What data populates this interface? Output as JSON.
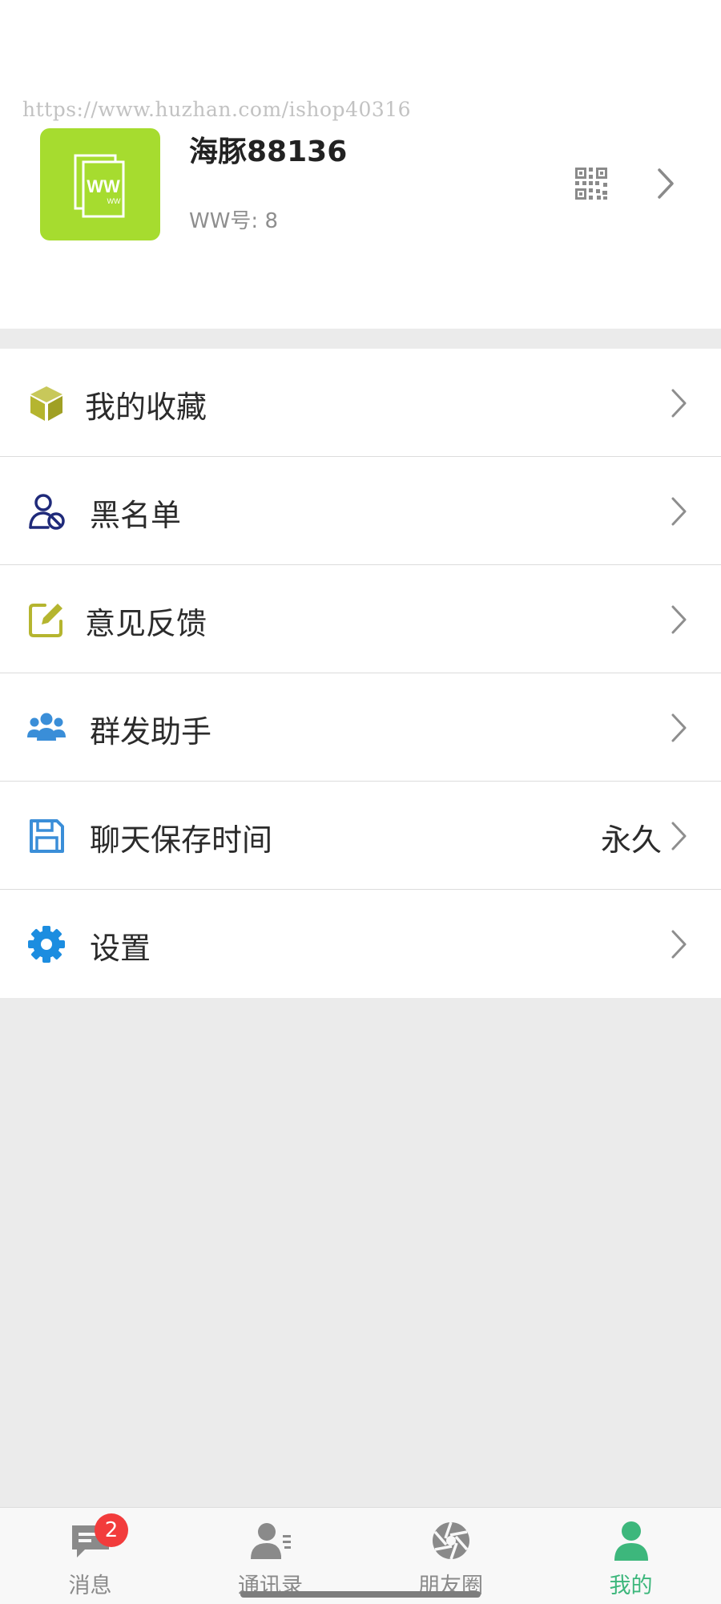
{
  "watermark": "https://www.huzhan.com/ishop40316",
  "profile": {
    "avatar_text_big": "WW",
    "avatar_text_small": "WW",
    "name": "海豚88136",
    "id_text": "WW号: 8",
    "avatar_color": "#a6dc2f"
  },
  "menu": {
    "items": [
      {
        "label": "我的收藏",
        "icon": "cube-icon",
        "color": "#b5b52f"
      },
      {
        "label": "黑名单",
        "icon": "user-block-icon",
        "color": "#1f2a7a"
      },
      {
        "label": "意见反馈",
        "icon": "edit-icon",
        "color": "#b5b52f"
      },
      {
        "label": "群发助手",
        "icon": "group-icon",
        "color": "#3a8ed8"
      },
      {
        "label": "聊天保存时间",
        "icon": "save-icon",
        "color": "#3a8ed8",
        "value": "永久"
      },
      {
        "label": "设置",
        "icon": "gear-icon",
        "color": "#1c8de0"
      }
    ]
  },
  "tabbar": {
    "tabs": [
      {
        "label": "消息",
        "icon": "chat-icon",
        "badge": "2"
      },
      {
        "label": "通讯录",
        "icon": "contacts-icon"
      },
      {
        "label": "朋友圈",
        "icon": "aperture-icon"
      },
      {
        "label": "我的",
        "icon": "person-icon",
        "active": true
      }
    ],
    "active_color": "#3db77c",
    "inactive_color": "#8a8a8a",
    "badge_color": "#f23c3c"
  }
}
